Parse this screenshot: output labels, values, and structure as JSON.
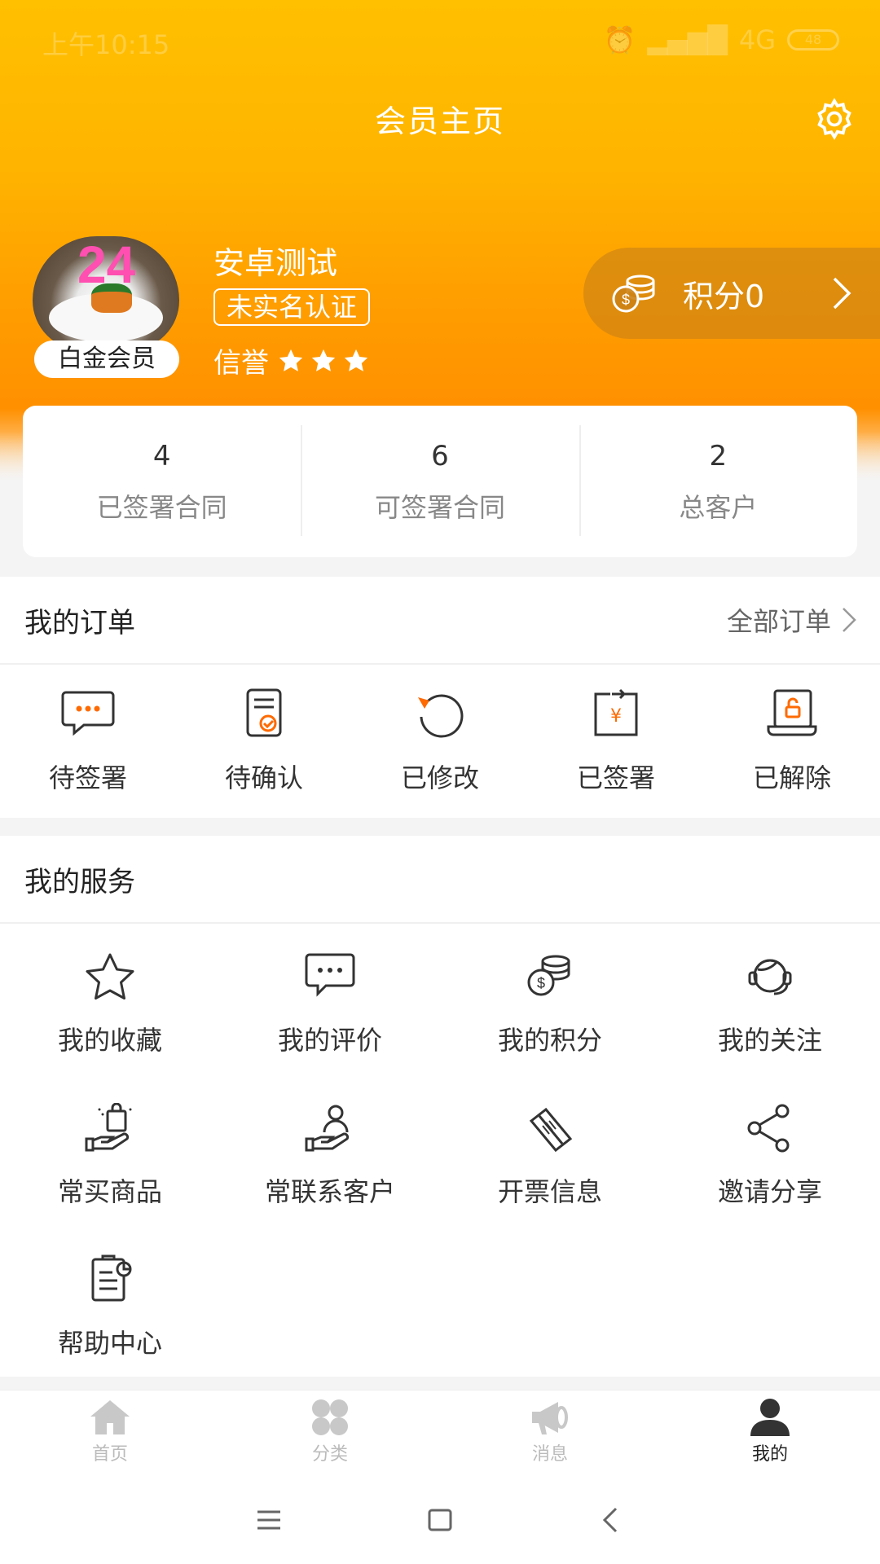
{
  "status_bar": {
    "time": "上午10:15",
    "network": "4G",
    "battery": "48"
  },
  "header": {
    "title": "会员主页"
  },
  "profile": {
    "member_level": "白金会员",
    "avatar_text": "24",
    "username": "安卓测试",
    "verify_status": "未实名认证",
    "credit_label": "信誉",
    "credit_stars": 3,
    "points_label": "积分0"
  },
  "stats": [
    {
      "value": "4",
      "label": "已签署合同"
    },
    {
      "value": "6",
      "label": "可签署合同"
    },
    {
      "value": "2",
      "label": "总客户"
    }
  ],
  "orders": {
    "title": "我的订单",
    "more_label": "全部订单",
    "items": [
      {
        "label": "待签署",
        "icon": "chat-bubble-icon"
      },
      {
        "label": "待确认",
        "icon": "checklist-icon"
      },
      {
        "label": "已修改",
        "icon": "refresh-icon"
      },
      {
        "label": "已签署",
        "icon": "yen-document-icon"
      },
      {
        "label": "已解除",
        "icon": "unlock-laptop-icon"
      }
    ]
  },
  "services": {
    "title": "我的服务",
    "items": [
      {
        "label": "我的收藏",
        "icon": "star-icon"
      },
      {
        "label": "我的评价",
        "icon": "comment-icon"
      },
      {
        "label": "我的积分",
        "icon": "coins-icon"
      },
      {
        "label": "我的关注",
        "icon": "headset-icon"
      },
      {
        "label": "常买商品",
        "icon": "shopping-bag-hand-icon"
      },
      {
        "label": "常联系客户",
        "icon": "customer-hand-icon"
      },
      {
        "label": "开票信息",
        "icon": "ticket-icon"
      },
      {
        "label": "邀请分享",
        "icon": "share-icon"
      },
      {
        "label": "帮助中心",
        "icon": "help-document-icon"
      }
    ]
  },
  "bottom_nav": [
    {
      "label": "首页",
      "icon": "home-icon",
      "active": false
    },
    {
      "label": "分类",
      "icon": "category-icon",
      "active": false
    },
    {
      "label": "消息",
      "icon": "megaphone-icon",
      "active": false
    },
    {
      "label": "我的",
      "icon": "user-icon",
      "active": true
    }
  ],
  "colors": {
    "accent": "#ff6a00",
    "header_top": "#ffc000",
    "header_bottom": "#ff9000",
    "icon_dark": "#333333"
  }
}
